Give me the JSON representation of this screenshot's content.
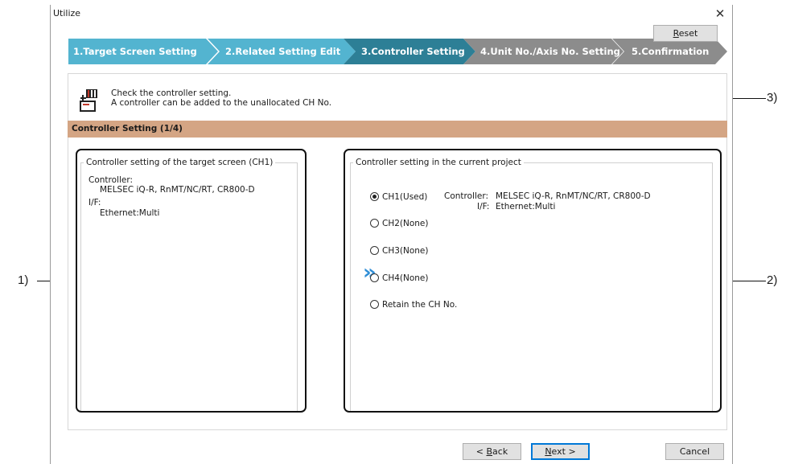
{
  "window": {
    "title": "Utilize"
  },
  "steps": [
    {
      "label": "1.Target Screen Setting",
      "state": "done"
    },
    {
      "label": "2.Related Setting Edit",
      "state": "done"
    },
    {
      "label": "3.Controller Setting",
      "state": "active"
    },
    {
      "label": "4.Unit No./Axis No. Setting",
      "state": "pending"
    },
    {
      "label": "5.Confirmation",
      "state": "pending"
    }
  ],
  "colors": {
    "step_done": "#53b4d0",
    "step_active": "#2d7f96",
    "step_pending": "#8c8c8c",
    "section_header": "#d4a584",
    "arrow": "#2f8ed6"
  },
  "info": {
    "icon": "controller-icon",
    "line1": "Check the controller setting.",
    "line2": "A controller can be added to the unallocated CH No."
  },
  "reset": {
    "prefix": "",
    "hotkey": "R",
    "rest": "eset"
  },
  "section": {
    "title": "Controller Setting (1/4)"
  },
  "target": {
    "legend": "Controller setting of the target screen (CH1)",
    "controller_label": "Controller:",
    "controller_value": "MELSEC iQ-R, RnMT/NC/RT, CR800-D",
    "if_label": "I/F:",
    "if_value": "Ethernet:Multi"
  },
  "arrow_glyph": "»",
  "current": {
    "legend": "Controller setting in the current project",
    "options": [
      {
        "label": "CH1(Used)",
        "checked": true
      },
      {
        "label": "CH2(None)",
        "checked": false
      },
      {
        "label": "CH3(None)",
        "checked": false
      },
      {
        "label": "CH4(None)",
        "checked": false
      },
      {
        "label": "Retain the CH No.",
        "checked": false
      }
    ],
    "ch1_controller_label": "Controller:",
    "ch1_controller_value": "MELSEC iQ-R, RnMT/NC/RT, CR800-D",
    "ch1_if_label": "I/F:",
    "ch1_if_value": "Ethernet:Multi"
  },
  "buttons": {
    "back": {
      "prefix": "< ",
      "hotkey": "B",
      "rest": "ack"
    },
    "next": {
      "prefix": "",
      "hotkey": "N",
      "rest": "ext >"
    },
    "cancel": "Cancel"
  },
  "callouts": {
    "left": "1)",
    "right": "2)",
    "reset": "3)"
  }
}
